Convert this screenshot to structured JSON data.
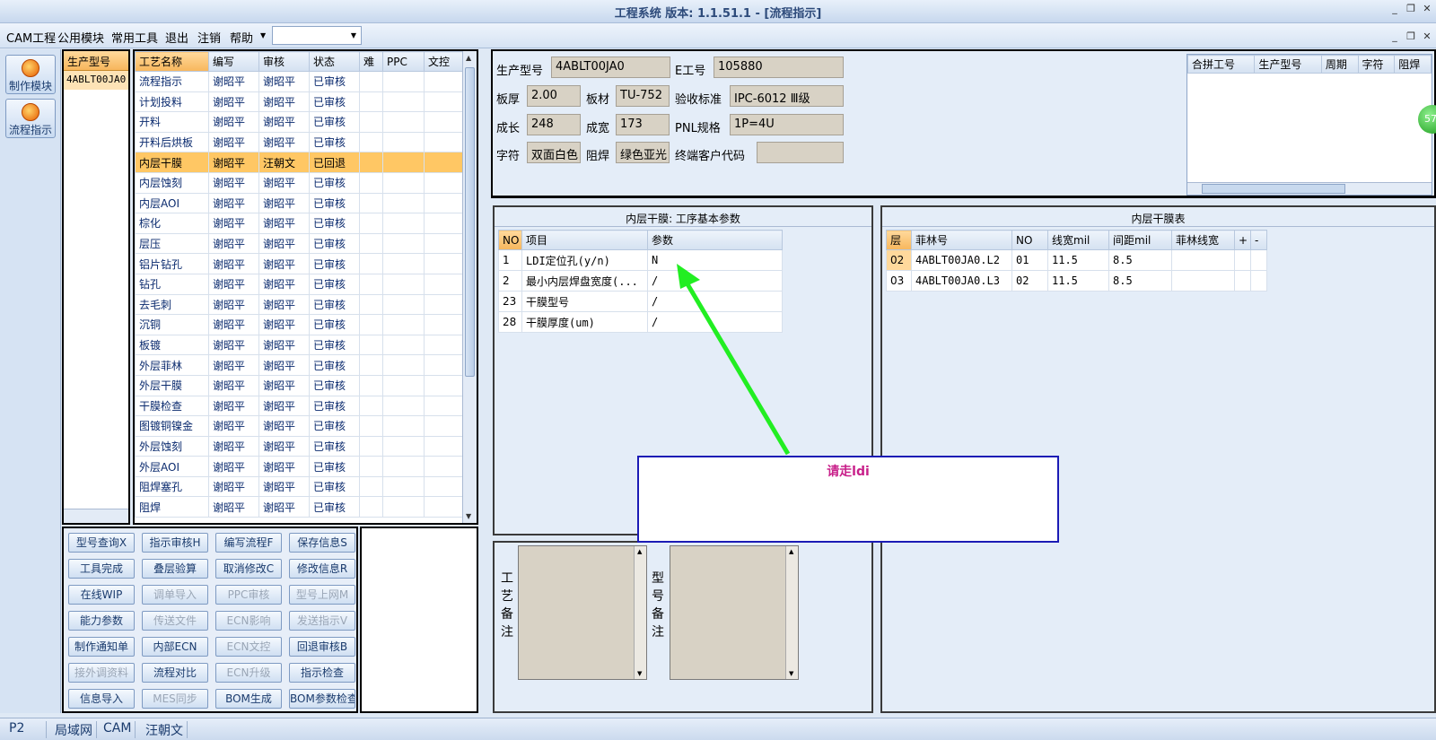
{
  "window": {
    "title": "工程系统  版本: 1.1.51.1 - [流程指示]",
    "controls": {
      "minimize": "_",
      "restore": "❐",
      "close": "✕"
    }
  },
  "menu": {
    "items": [
      "CAM工程",
      "公用模块",
      "常用工具",
      "退出",
      "注销",
      "帮助"
    ],
    "combo_value": ""
  },
  "left_toolbar": [
    {
      "label": "制作模块",
      "icon": "flame-icon"
    },
    {
      "label": "流程指示",
      "icon": "flow-icon"
    }
  ],
  "model_list": {
    "header": "生产型号",
    "rows": [
      "4ABLT00JA0"
    ]
  },
  "process_table": {
    "columns": [
      "工艺名称",
      "编写",
      "审核",
      "状态",
      "难",
      "PPC",
      "文控"
    ],
    "rows": [
      [
        "流程指示",
        "谢昭平",
        "谢昭平",
        "已审核"
      ],
      [
        "计划投料",
        "谢昭平",
        "谢昭平",
        "已审核"
      ],
      [
        "开料",
        "谢昭平",
        "谢昭平",
        "已审核"
      ],
      [
        "开料后烘板",
        "谢昭平",
        "谢昭平",
        "已审核"
      ],
      [
        "内层干膜",
        "谢昭平",
        "汪朝文",
        "已回退"
      ],
      [
        "内层蚀刻",
        "谢昭平",
        "谢昭平",
        "已审核"
      ],
      [
        "内层AOI",
        "谢昭平",
        "谢昭平",
        "已审核"
      ],
      [
        "棕化",
        "谢昭平",
        "谢昭平",
        "已审核"
      ],
      [
        "层压",
        "谢昭平",
        "谢昭平",
        "已审核"
      ],
      [
        "铝片钻孔",
        "谢昭平",
        "谢昭平",
        "已审核"
      ],
      [
        "钻孔",
        "谢昭平",
        "谢昭平",
        "已审核"
      ],
      [
        "去毛刺",
        "谢昭平",
        "谢昭平",
        "已审核"
      ],
      [
        "沉铜",
        "谢昭平",
        "谢昭平",
        "已审核"
      ],
      [
        "板镀",
        "谢昭平",
        "谢昭平",
        "已审核"
      ],
      [
        "外层菲林",
        "谢昭平",
        "谢昭平",
        "已审核"
      ],
      [
        "外层干膜",
        "谢昭平",
        "谢昭平",
        "已审核"
      ],
      [
        "干膜检查",
        "谢昭平",
        "谢昭平",
        "已审核"
      ],
      [
        "图镀铜镍金",
        "谢昭平",
        "谢昭平",
        "已审核"
      ],
      [
        "外层蚀刻",
        "谢昭平",
        "谢昭平",
        "已审核"
      ],
      [
        "外层AOI",
        "谢昭平",
        "谢昭平",
        "已审核"
      ],
      [
        "阻焊塞孔",
        "谢昭平",
        "谢昭平",
        "已审核"
      ],
      [
        "阻焊",
        "谢昭平",
        "谢昭平",
        "已审核"
      ]
    ],
    "selected_index": 4
  },
  "function_buttons": [
    [
      {
        "label": "型号查询X",
        "enabled": true
      },
      {
        "label": "指示审核H",
        "enabled": true
      },
      {
        "label": "编写流程F",
        "enabled": true
      },
      {
        "label": "保存信息S",
        "enabled": true
      }
    ],
    [
      {
        "label": "工具完成",
        "enabled": true
      },
      {
        "label": "叠层验算",
        "enabled": true
      },
      {
        "label": "取消修改C",
        "enabled": true
      },
      {
        "label": "修改信息R",
        "enabled": true
      }
    ],
    [
      {
        "label": "在线WIP",
        "enabled": true
      },
      {
        "label": "调单导入",
        "enabled": false
      },
      {
        "label": "PPC审核",
        "enabled": false
      },
      {
        "label": "型号上网M",
        "enabled": false
      }
    ],
    [
      {
        "label": "能力参数",
        "enabled": true
      },
      {
        "label": "传送文件",
        "enabled": false
      },
      {
        "label": "ECN影响",
        "enabled": false
      },
      {
        "label": "发送指示V",
        "enabled": false
      }
    ],
    [
      {
        "label": "制作通知单",
        "enabled": true
      },
      {
        "label": "内部ECN",
        "enabled": true
      },
      {
        "label": "ECN文控",
        "enabled": false
      },
      {
        "label": "回退审核B",
        "enabled": true
      }
    ],
    [
      {
        "label": "接外调资料",
        "enabled": false
      },
      {
        "label": "流程对比",
        "enabled": true
      },
      {
        "label": "ECN升级",
        "enabled": false
      },
      {
        "label": "指示检查",
        "enabled": true
      }
    ],
    [
      {
        "label": "信息导入",
        "enabled": true
      },
      {
        "label": "MES同步",
        "enabled": false
      },
      {
        "label": "BOM生成",
        "enabled": true
      },
      {
        "label": "BOM参数检查",
        "enabled": true
      }
    ]
  ],
  "info": {
    "model_label": "生产型号",
    "model_value": "4ABLT00JA0",
    "e_label": "E工号",
    "e_value": "105880",
    "thickness_label": "板厚",
    "thickness_value": "2.00",
    "material_label": "板材",
    "material_value": "TU-752",
    "standard_label": "验收标准",
    "standard_value": "IPC-6012 Ⅲ级",
    "length_label": "成长",
    "length_value": "248",
    "width_label": "成宽",
    "width_value": "173",
    "pnl_label": "PNL规格",
    "pnl_value": "1P=4U",
    "char_label": "字符",
    "char_value": "双面白色",
    "mask_label": "阻焊",
    "mask_value": "绿色亚光",
    "customer_label": "终端客户代码",
    "customer_value": ""
  },
  "combine_grid": {
    "columns": [
      "合拼工号",
      "生产型号",
      "周期",
      "字符",
      "阻焊"
    ]
  },
  "float_badge": "57",
  "param_panel": {
    "title": "内层干膜: 工序基本参数",
    "columns": [
      "NO",
      "项目",
      "参数"
    ],
    "rows": [
      [
        "1",
        "LDI定位孔(y/n)",
        "N"
      ],
      [
        "2",
        "最小内层焊盘宽度(...",
        "/"
      ],
      [
        "23",
        "干膜型号",
        "/"
      ],
      [
        "28",
        "干膜厚度(um)",
        "/"
      ]
    ]
  },
  "dry_panel": {
    "title": "内层干膜表",
    "columns": [
      "层",
      "菲林号",
      "NO",
      "线宽mil",
      "间距mil",
      "菲林线宽",
      "+",
      "-"
    ],
    "rows": [
      [
        "02",
        "4ABLT00JA0.L2",
        "01",
        "11.5",
        "8.5",
        ""
      ],
      [
        "03",
        "4ABLT00JA0.L3",
        "02",
        "11.5",
        "8.5",
        ""
      ]
    ]
  },
  "memos": {
    "process_label": "工艺备注",
    "model_label": "型号备注"
  },
  "callout": {
    "text": "请走ldi"
  },
  "statusbar": {
    "p_value": "P2",
    "items": [
      "局域网",
      "CAM",
      "汪朝文"
    ]
  },
  "colors": {
    "accent_orange": "#f7b65c",
    "callout_border": "#1b1bb5",
    "callout_text": "#c8208a",
    "arrow": "#22ee22"
  }
}
